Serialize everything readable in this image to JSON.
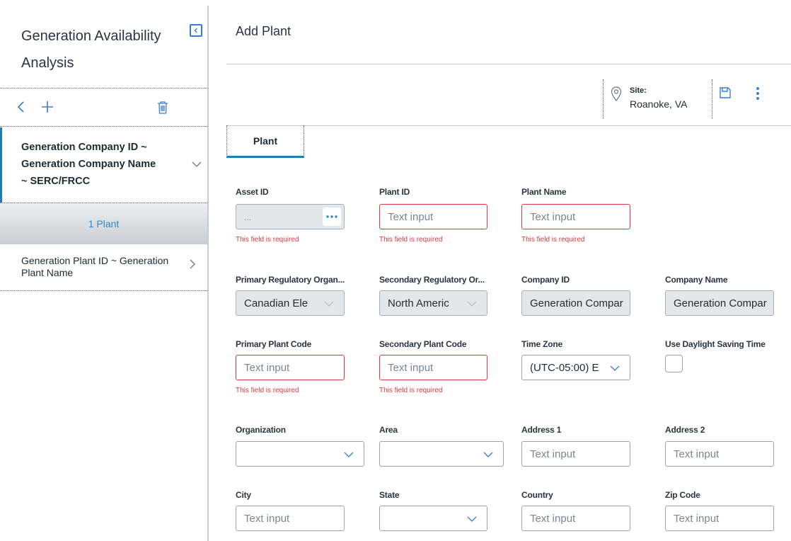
{
  "sidebar": {
    "title": "Generation Availability Analysis",
    "items": [
      {
        "label": "Generation Company ID ~ Generation Company Name ~ SERC/FRCC"
      },
      {
        "label": "1 Plant"
      },
      {
        "label": "Generation Plant ID ~ Generation Plant Name"
      }
    ]
  },
  "header": {
    "title": "Add Plant",
    "site_label": "Site:",
    "site_value": "Roanoke, VA"
  },
  "tabs": [
    {
      "label": "Plant"
    }
  ],
  "form": {
    "asset_id": {
      "label": "Asset ID",
      "value": "...",
      "error": "This field is required"
    },
    "plant_id": {
      "label": "Plant ID",
      "placeholder": "Text input",
      "error": "This field is required"
    },
    "plant_name": {
      "label": "Plant Name",
      "placeholder": "Text input",
      "error": "This field is required"
    },
    "primary_reg_org": {
      "label": "Primary Regulatory Organ...",
      "value": "Canadian Ele"
    },
    "secondary_reg_org": {
      "label": "Secondary Regulatory Or...",
      "value": "North Americ"
    },
    "company_id": {
      "label": "Company ID",
      "value": "Generation Compar"
    },
    "company_name": {
      "label": "Company Name",
      "value": "Generation Compar"
    },
    "primary_plant_code": {
      "label": "Primary Plant Code",
      "placeholder": "Text input",
      "error": "This field is required"
    },
    "secondary_plant_code": {
      "label": "Secondary Plant Code",
      "placeholder": "Text input",
      "error": "This field is required"
    },
    "time_zone": {
      "label": "Time Zone",
      "value": "(UTC-05:00) E"
    },
    "dst": {
      "label": "Use Daylight Saving Time",
      "checked": false
    },
    "organization": {
      "label": "Organization",
      "value": ""
    },
    "area": {
      "label": "Area",
      "value": ""
    },
    "address1": {
      "label": "Address 1",
      "placeholder": "Text input"
    },
    "address2": {
      "label": "Address 2",
      "placeholder": "Text input"
    },
    "city": {
      "label": "City",
      "placeholder": "Text input"
    },
    "state": {
      "label": "State",
      "value": ""
    },
    "country": {
      "label": "Country",
      "placeholder": "Text input"
    },
    "zip": {
      "label": "Zip Code",
      "placeholder": "Text input"
    }
  },
  "colors": {
    "accent": "#1a7fb6",
    "error": "#e0393e",
    "link": "#2e87c8"
  },
  "icons": [
    "collapse-icon",
    "back-icon",
    "add-icon",
    "trash-icon",
    "chevron-down-icon",
    "chevron-right-icon",
    "location-pin-icon",
    "save-icon",
    "more-vertical-icon",
    "ellipsis-icon"
  ]
}
